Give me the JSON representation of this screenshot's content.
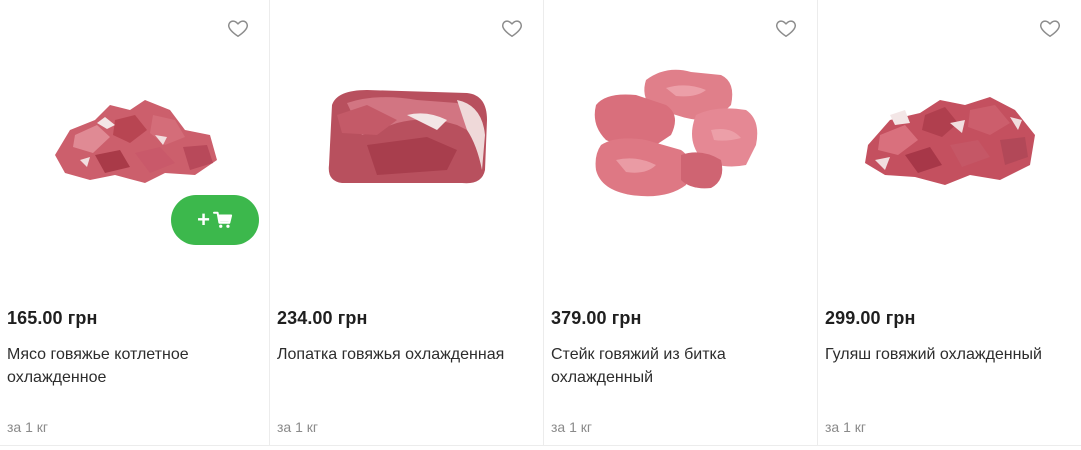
{
  "products": [
    {
      "price": "165.00 грн",
      "title": "Мясо говяжье котлетное охлажденное",
      "unit": "за 1 кг",
      "image_icon": "beef-cubes-image",
      "favorite_icon": "heart-outline-icon"
    },
    {
      "price": "234.00 грн",
      "title": "Лопатка говяжья охлажденная",
      "unit": "за 1 кг",
      "image_icon": "beef-shoulder-image",
      "favorite_icon": "heart-outline-icon"
    },
    {
      "price": "379.00 грн",
      "title": "Стейк говяжий из битка охлажденный",
      "unit": "за 1 кг",
      "image_icon": "beef-steaks-image",
      "favorite_icon": "heart-outline-icon"
    },
    {
      "price": "299.00 грн",
      "title": "Гуляш говяжий охлажденный",
      "unit": "за 1 кг",
      "image_icon": "beef-goulash-image",
      "favorite_icon": "heart-outline-icon"
    }
  ],
  "add_to_cart": {
    "label": "+",
    "icon": "cart-icon",
    "color": "#3cb84c"
  },
  "colors": {
    "meat_light": "#d8737f",
    "meat_dark": "#b5424f",
    "fat": "#f3e6e6"
  }
}
